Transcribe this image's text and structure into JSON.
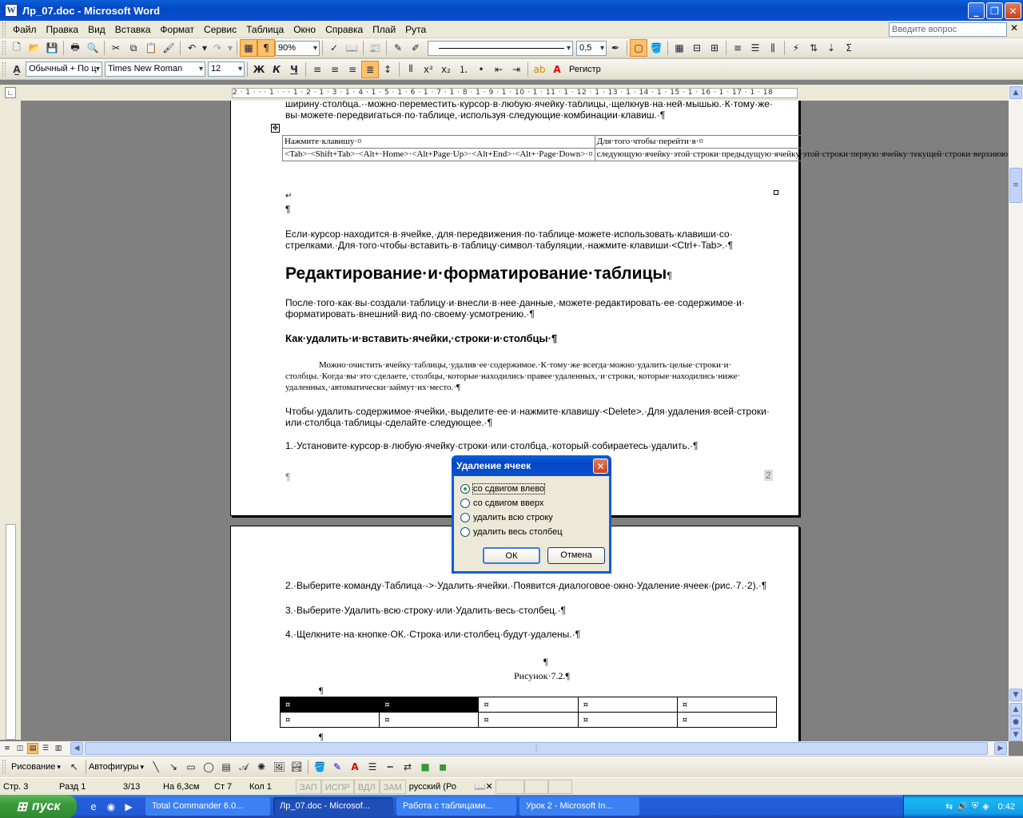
{
  "window": {
    "title": "Лр_07.doc - Microsoft Word",
    "icon": "W"
  },
  "menu": {
    "items": [
      "Файл",
      "Правка",
      "Вид",
      "Вставка",
      "Формат",
      "Сервис",
      "Таблица",
      "Окно",
      "Справка",
      "Плай",
      "Рута"
    ],
    "help_placeholder": "Введите вопрос"
  },
  "toolbar1": {
    "zoom": "90%",
    "line_weight": "0,5"
  },
  "toolbar3": {
    "style": "Обычный + По ц",
    "font": "Times New Roman",
    "size": "12",
    "bold": "Ж",
    "italic": "К",
    "underline": "Ч",
    "register": "Регистр"
  },
  "ruler": {
    "text": "2 · 1 · · · 1 · · · 1 · 2 · 1 · 3 · 1 · 4 · 1 · 5 · 1 · 6 · 1 · 7 · 1 · 8 · 1 · 9 · 1 · 10 · 1 · 11 · 1 · 12 · 1 · 13 · 1 · 14 · 1 · 15 · 1 · 16 · 1 · 17 · 1 · 18"
  },
  "page1": {
    "line_top1": "ширину·столбца.··можно·переместить·курсор·в·любую·ячейку·таблицы,·щелкнув·на·ней·мышью.·К·тому·же·",
    "line_top2": "вы·можете·передвигаться·по·таблице,·используя·следующие·комбинации·клавиш.·¶",
    "table": {
      "header1": "Нажмите·клавишу·¤",
      "header2": "Для·того·чтобы·перейти·в·¤",
      "cell1": "<Tab>·<Shift+Tab>·<Alt+·Home>·<Alt+Page·Up>·<Alt+End>·<Alt+·Page·Down>·¤",
      "cell2": "следующую·ячейку·этой·строки·предыдущую·ячейку·этой·строки·первую·ячейку·текущей·строки·верхнюю·ячейку·текущего·столбца·последнюю·ячейку·текущей·строки·последнюю·ячейку·текущего·столбца·¤"
    },
    "mark_after_table": "↵",
    "pilcrow": "¶",
    "para1_l1": "Если·курсор·находится·в·ячейке,·для·передвижения·по·таблице·можете·использовать·клавиши·со·",
    "para1_l2": "стрелками.·Для·того·чтобы·вставить·в·таблицу·символ·табуляции,·нажмите·клавиши·<Ctrl+·Tab>.·¶",
    "heading1": "Редактирование·и·форматирование·таблицы",
    "heading1_mark": "¶",
    "para2_l1": "После·того·как·вы·создали·таблицу·и·внесли·в·нее·данные,·можете·редактировать·ее·содержимое·и·",
    "para2_l2": "форматировать·внешний·вид·по·своему·усмотрению.·¶",
    "heading2": "Как·удалить·и·вставить·ячейки,·строки·и·столбцы·¶",
    "para3_l1": "Можно·очистить·ячейку·таблицы,·удалив·ее·содержимое.·К·тому·же·всегда·можно·удалить·целые·строки·и·",
    "para3_l2": "столбцы.·Когда·вы·это·сделаете,·столбцы,·которые·находились·правее·удаленных,·и·строки,·которые·находились·ниже·",
    "para3_l3": "удаленных,·автоматически·займут·их·место.·¶",
    "para4_l1": "Чтобы·удалить·содержимое·ячейки,·выделите·ее·и·нажмите·клавишу·<Delete>.·Для·удаления·всей·строки·",
    "para4_l2": "или·столбца·таблицы·сделайте·следующее.·¶",
    "step1": "1.·Установите·курсор·в·любую·ячейку·строки·или·столбца,·который·собираетесь·удалить.·¶",
    "footer_mark": "¶",
    "page_number": "2"
  },
  "page2": {
    "step2": "2.·Выберите·команду·Таблица·->·Удалить·ячейки.·Появится·диалоговое·окно·Удаление·ячеек·(рис.·7.·2).·¶",
    "step3": "3.·Выберите·Удалить·всю·строку·или·Удалить·весь·столбец.·¶",
    "step4": "4.·Щелкните·на·кнопке·ОК.·Строка·или·столбец·будут·удалены.·¶",
    "pilcrow": "¶",
    "figure_caption": "Рисунок·7.2.¶",
    "cell_mark": "¤"
  },
  "dialog": {
    "title": "Удаление ячеек",
    "options": [
      "со сдвигом влево",
      "со сдвигом вверх",
      "удалить всю строку",
      "удалить весь столбец"
    ],
    "selected": 0,
    "ok": "ОК",
    "cancel": "Отмена"
  },
  "drawbar": {
    "draw": "Рисование",
    "autoshapes": "Автофигуры"
  },
  "status": {
    "page": "Стр. 3",
    "section": "Разд 1",
    "pages": "3/13",
    "at": "На 6,3см",
    "line": "Ст 7",
    "col": "Кол 1",
    "rec": "ЗАП",
    "trk": "ИСПР",
    "ext": "ВДЛ",
    "ovr": "ЗАМ",
    "lang": "русский (Ро"
  },
  "taskbar": {
    "start": "пуск",
    "tasks": [
      "Total Commander 6.0...",
      "Лр_07.doc - Microsof...",
      "Работа с таблицами...",
      "Урок 2 - Microsoft In..."
    ],
    "active": 1,
    "lang": "RU",
    "clock": "0:42"
  }
}
